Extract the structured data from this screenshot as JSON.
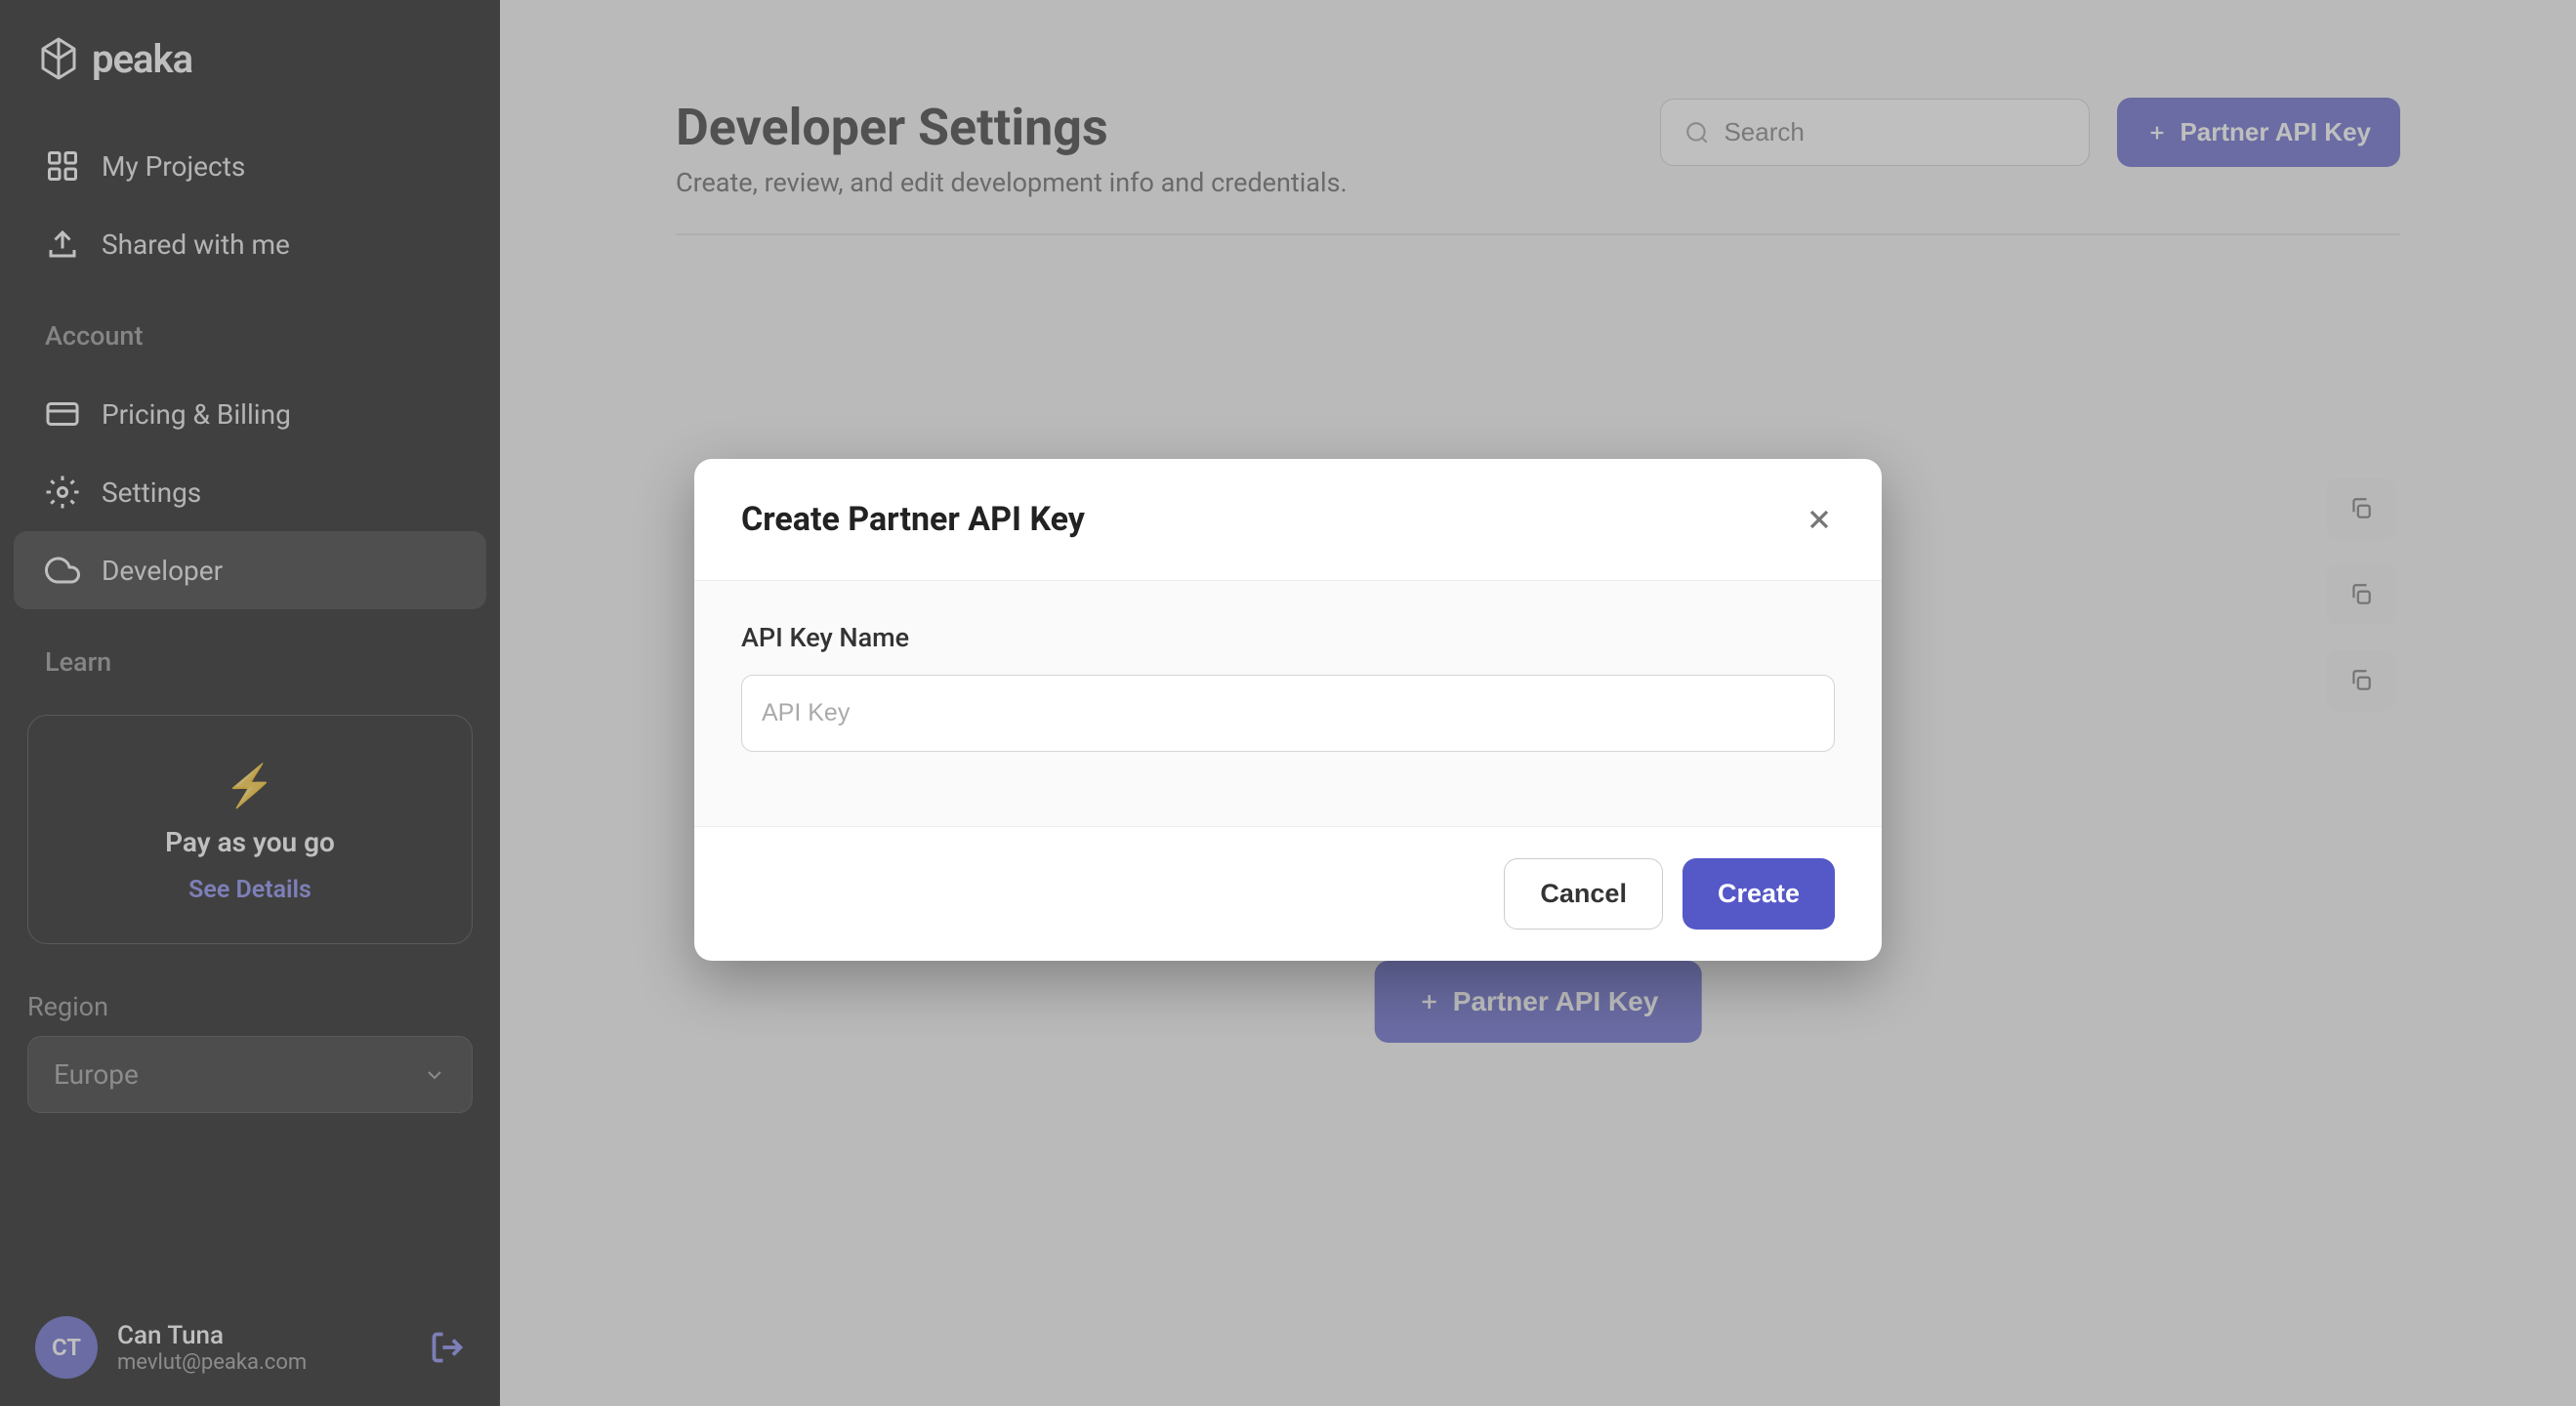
{
  "logo": {
    "text": "peaka"
  },
  "sidebar": {
    "nav": {
      "my_projects": "My Projects",
      "shared_with_me": "Shared with me"
    },
    "account": {
      "title": "Account",
      "pricing_billing": "Pricing & Billing",
      "settings": "Settings",
      "developer": "Developer"
    },
    "learn": {
      "title": "Learn"
    },
    "promo": {
      "icon": "⚡",
      "title": "Pay as you go",
      "link": "See Details"
    },
    "region": {
      "label": "Region",
      "value": "Europe"
    },
    "user": {
      "initials": "CT",
      "name": "Can Tuna",
      "email": "mevlut@peaka.com"
    }
  },
  "page": {
    "title": "Developer Settings",
    "subtitle": "Create, review, and edit development info and credentials.",
    "search_placeholder": "Search",
    "partner_api_key_btn": "Partner API Key"
  },
  "modal": {
    "title": "Create Partner API Key",
    "field_label": "API Key Name",
    "field_placeholder": "API Key",
    "cancel": "Cancel",
    "create": "Create"
  }
}
